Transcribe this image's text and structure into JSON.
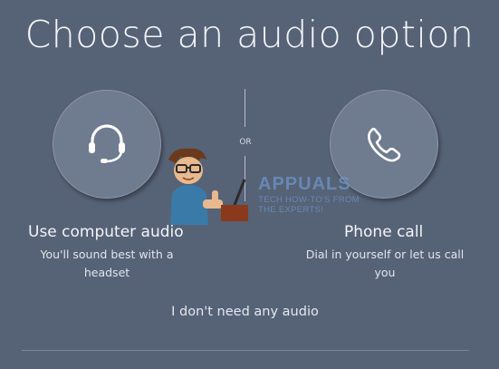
{
  "dialog": {
    "title": "Choose an audio option",
    "separator_label": "OR",
    "no_audio_link": "I don't need any audio"
  },
  "options": {
    "computer_audio": {
      "icon": "headset-icon",
      "label": "Use computer audio",
      "description_line1": "You'll sound best with a",
      "description_line2": "headset"
    },
    "phone_call": {
      "icon": "phone-icon",
      "label": "Phone call",
      "description_line1": "Dial in yourself or let us call",
      "description_line2": "you"
    }
  },
  "watermark": {
    "brand": "APPUALS",
    "tagline_line1": "TECH HOW-TO'S FROM",
    "tagline_line2": "THE EXPERTS!"
  },
  "colors": {
    "background": "#566276",
    "circle_fill": "#6f7b8e",
    "text": "#ffffff"
  }
}
